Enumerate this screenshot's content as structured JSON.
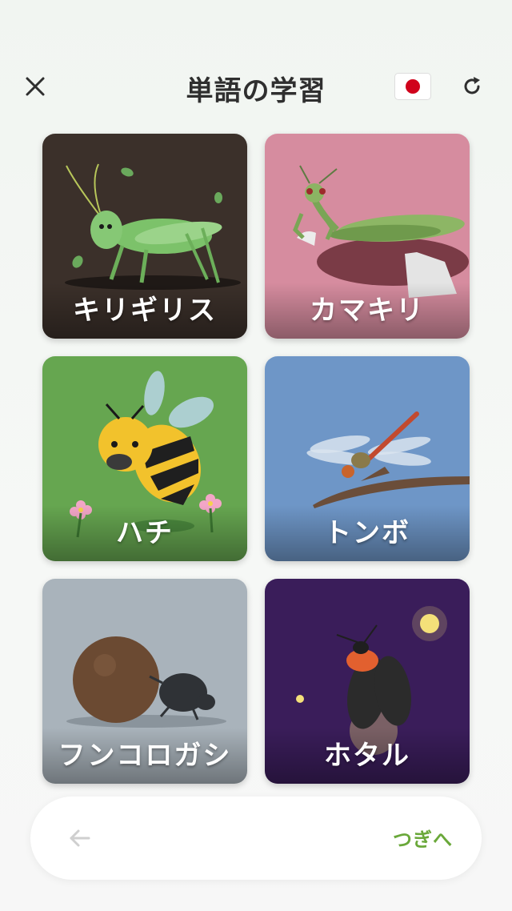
{
  "header": {
    "title": "単語の学習",
    "close_icon": "close-icon",
    "flag_icon": "japan-flag-icon",
    "refresh_icon": "refresh-icon"
  },
  "cards": [
    {
      "label": "キリギリス",
      "icon": "katydid-image",
      "bg": "#3b302a"
    },
    {
      "label": "カマキリ",
      "icon": "mantis-image",
      "bg": "#d68c9f"
    },
    {
      "label": "ハチ",
      "icon": "bee-image",
      "bg": "#66a650"
    },
    {
      "label": "トンボ",
      "icon": "dragonfly-image",
      "bg": "#6e96c7"
    },
    {
      "label": "フンコロガシ",
      "icon": "dung-beetle-image",
      "bg": "#a9b3bb"
    },
    {
      "label": "ホタル",
      "icon": "firefly-image",
      "bg": "#3a1d5a"
    }
  ],
  "footer": {
    "back_icon": "arrow-left-icon",
    "next_label": "つぎへ"
  },
  "colors": {
    "accent": "#6aa83a",
    "title": "#2f2f2f"
  }
}
